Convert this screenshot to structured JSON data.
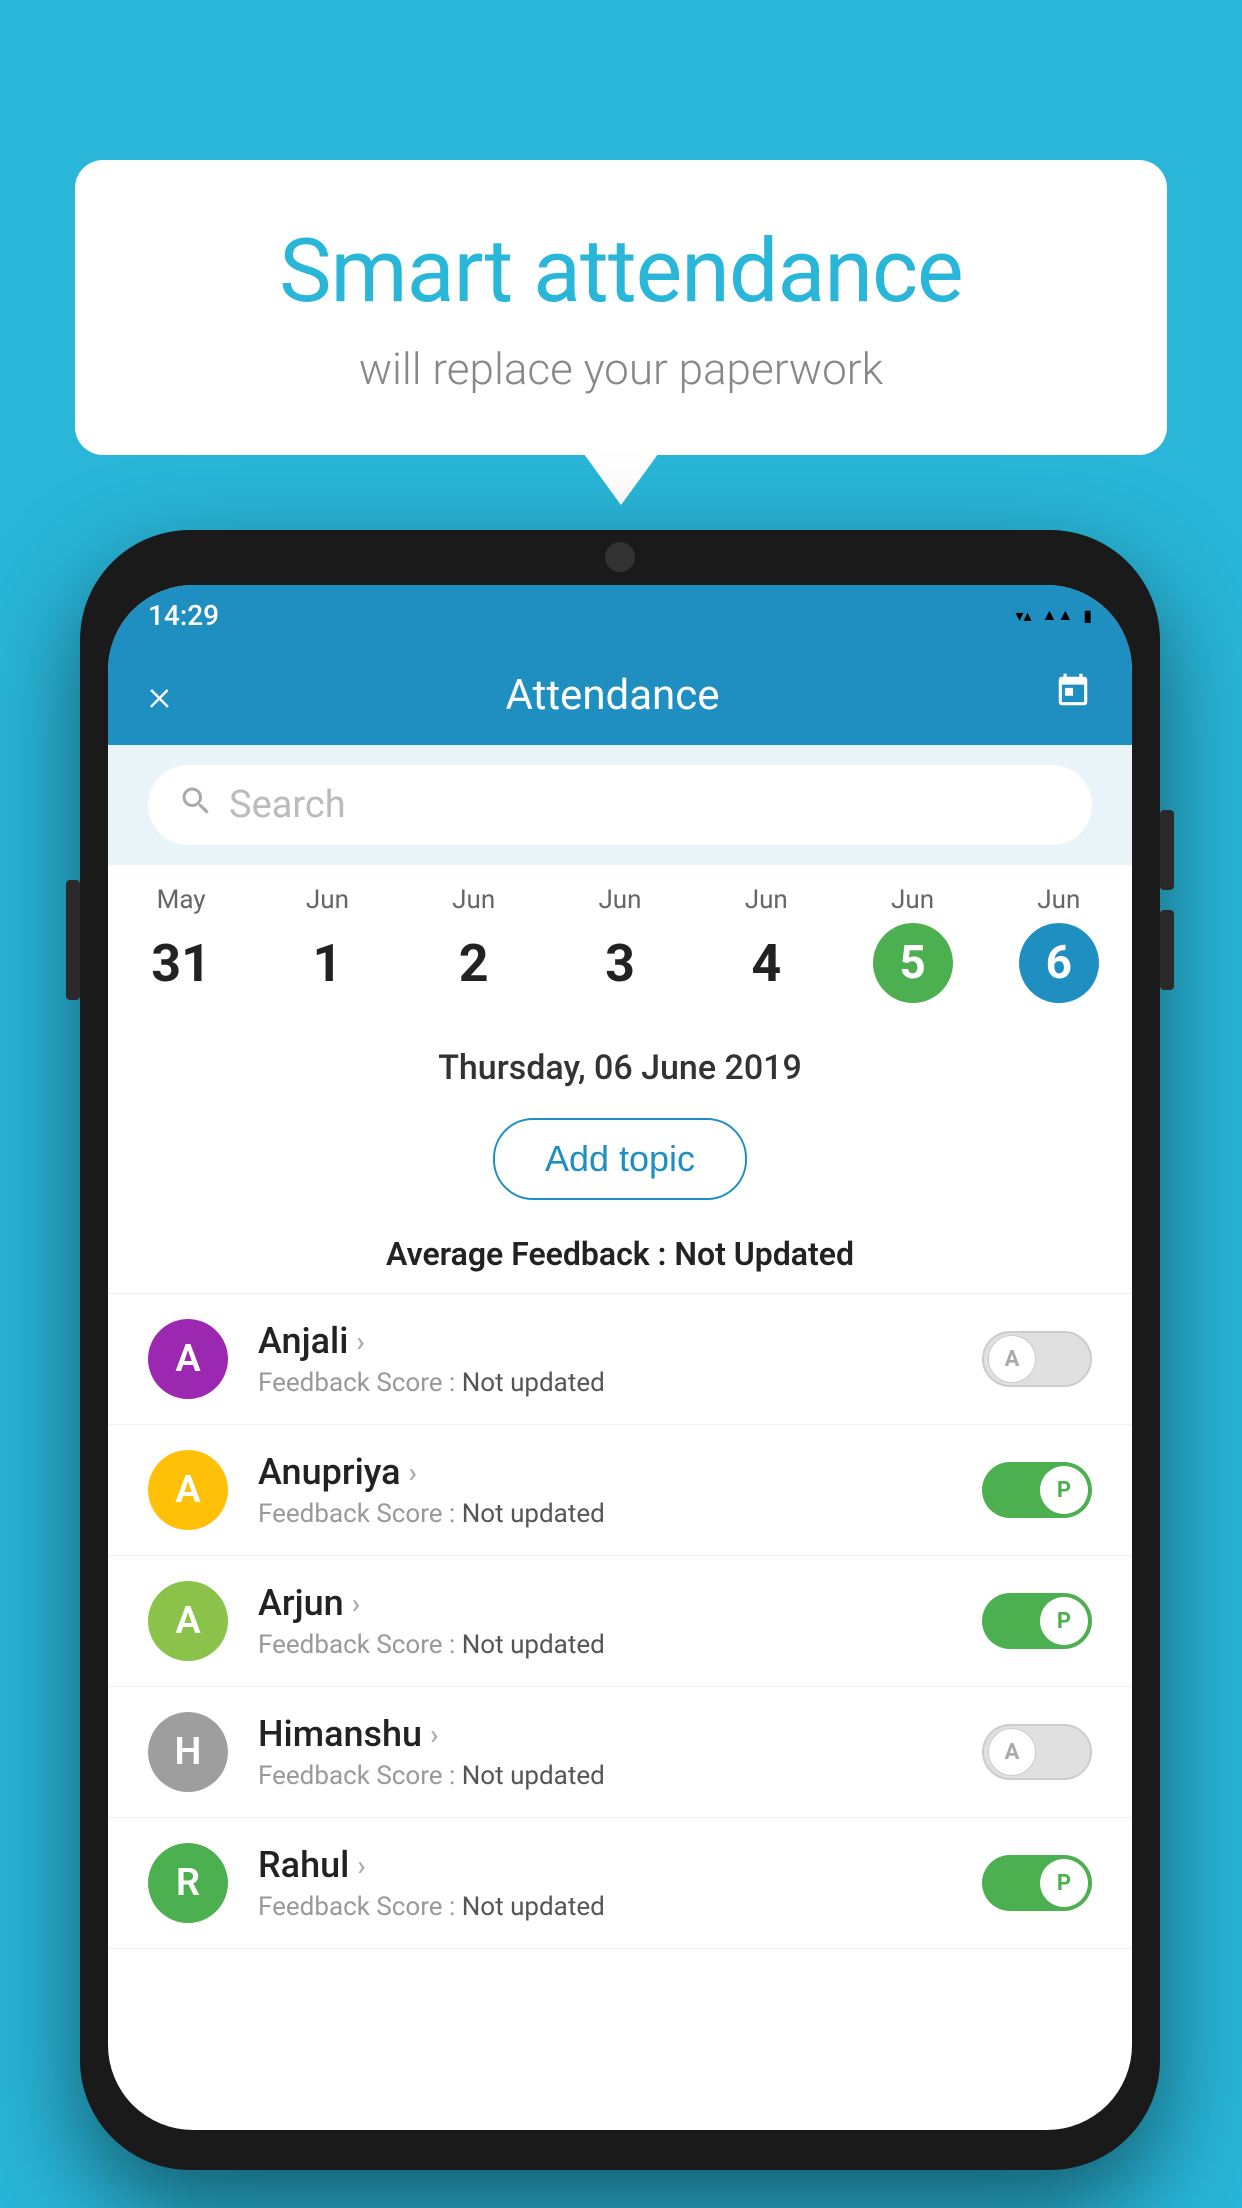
{
  "background_color": "#29b6d8",
  "speech_bubble": {
    "title": "Smart attendance",
    "subtitle": "will replace your paperwork"
  },
  "status_bar": {
    "time": "14:29",
    "icons": [
      "wifi",
      "signal",
      "battery"
    ]
  },
  "header": {
    "title": "Attendance",
    "close_label": "×",
    "calendar_icon": "calendar"
  },
  "search": {
    "placeholder": "Search"
  },
  "calendar": {
    "days": [
      {
        "month": "May",
        "date": "31",
        "type": "normal"
      },
      {
        "month": "Jun",
        "date": "1",
        "type": "normal"
      },
      {
        "month": "Jun",
        "date": "2",
        "type": "normal"
      },
      {
        "month": "Jun",
        "date": "3",
        "type": "normal"
      },
      {
        "month": "Jun",
        "date": "4",
        "type": "normal"
      },
      {
        "month": "Jun",
        "date": "5",
        "type": "today"
      },
      {
        "month": "Jun",
        "date": "6",
        "type": "selected"
      }
    ]
  },
  "selected_date_label": "Thursday, 06 June 2019",
  "add_topic_label": "Add topic",
  "feedback_summary": {
    "label": "Average Feedback : ",
    "value": "Not Updated"
  },
  "students": [
    {
      "name": "Anjali",
      "avatar_letter": "A",
      "avatar_color": "#9c27b0",
      "feedback_label": "Feedback Score : ",
      "feedback_value": "Not updated",
      "toggle": "off",
      "toggle_letter": "A"
    },
    {
      "name": "Anupriya",
      "avatar_letter": "A",
      "avatar_color": "#ffc107",
      "feedback_label": "Feedback Score : ",
      "feedback_value": "Not updated",
      "toggle": "on",
      "toggle_letter": "P"
    },
    {
      "name": "Arjun",
      "avatar_letter": "A",
      "avatar_color": "#8bc34a",
      "feedback_label": "Feedback Score : ",
      "feedback_value": "Not updated",
      "toggle": "on",
      "toggle_letter": "P"
    },
    {
      "name": "Himanshu",
      "avatar_letter": "H",
      "avatar_color": "#9e9e9e",
      "feedback_label": "Feedback Score : ",
      "feedback_value": "Not updated",
      "toggle": "off",
      "toggle_letter": "A"
    },
    {
      "name": "Rahul",
      "avatar_letter": "R",
      "avatar_color": "#4caf50",
      "feedback_label": "Feedback Score : ",
      "feedback_value": "Not updated",
      "toggle": "on",
      "toggle_letter": "P"
    }
  ]
}
